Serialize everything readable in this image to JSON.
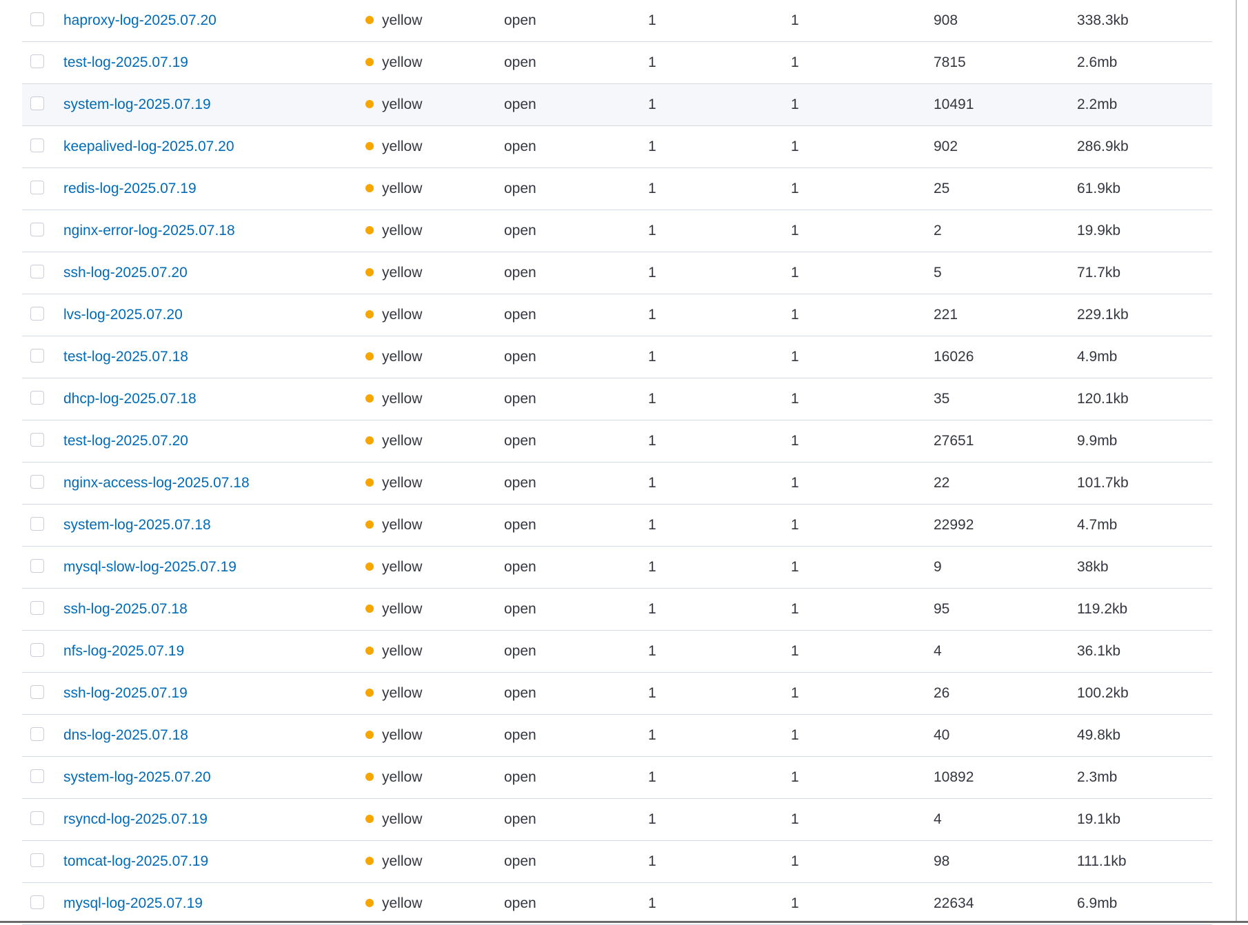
{
  "colors": {
    "health_yellow": "#f5a700",
    "link": "#006bb8",
    "text": "#343741",
    "row_border": "#d3dae6",
    "hover_row": "#f5f7fa"
  },
  "rows": [
    {
      "name": "haproxy-log-2025.07.20",
      "health": "yellow",
      "status": "open",
      "primaries": "1",
      "replicas": "1",
      "docs_count": "908",
      "storage_size": "338.3kb"
    },
    {
      "name": "test-log-2025.07.19",
      "health": "yellow",
      "status": "open",
      "primaries": "1",
      "replicas": "1",
      "docs_count": "7815",
      "storage_size": "2.6mb"
    },
    {
      "name": "system-log-2025.07.19",
      "health": "yellow",
      "status": "open",
      "primaries": "1",
      "replicas": "1",
      "docs_count": "10491",
      "storage_size": "2.2mb"
    },
    {
      "name": "keepalived-log-2025.07.20",
      "health": "yellow",
      "status": "open",
      "primaries": "1",
      "replicas": "1",
      "docs_count": "902",
      "storage_size": "286.9kb"
    },
    {
      "name": "redis-log-2025.07.19",
      "health": "yellow",
      "status": "open",
      "primaries": "1",
      "replicas": "1",
      "docs_count": "25",
      "storage_size": "61.9kb"
    },
    {
      "name": "nginx-error-log-2025.07.18",
      "health": "yellow",
      "status": "open",
      "primaries": "1",
      "replicas": "1",
      "docs_count": "2",
      "storage_size": "19.9kb"
    },
    {
      "name": "ssh-log-2025.07.20",
      "health": "yellow",
      "status": "open",
      "primaries": "1",
      "replicas": "1",
      "docs_count": "5",
      "storage_size": "71.7kb"
    },
    {
      "name": "lvs-log-2025.07.20",
      "health": "yellow",
      "status": "open",
      "primaries": "1",
      "replicas": "1",
      "docs_count": "221",
      "storage_size": "229.1kb"
    },
    {
      "name": "test-log-2025.07.18",
      "health": "yellow",
      "status": "open",
      "primaries": "1",
      "replicas": "1",
      "docs_count": "16026",
      "storage_size": "4.9mb"
    },
    {
      "name": "dhcp-log-2025.07.18",
      "health": "yellow",
      "status": "open",
      "primaries": "1",
      "replicas": "1",
      "docs_count": "35",
      "storage_size": "120.1kb"
    },
    {
      "name": "test-log-2025.07.20",
      "health": "yellow",
      "status": "open",
      "primaries": "1",
      "replicas": "1",
      "docs_count": "27651",
      "storage_size": "9.9mb"
    },
    {
      "name": "nginx-access-log-2025.07.18",
      "health": "yellow",
      "status": "open",
      "primaries": "1",
      "replicas": "1",
      "docs_count": "22",
      "storage_size": "101.7kb"
    },
    {
      "name": "system-log-2025.07.18",
      "health": "yellow",
      "status": "open",
      "primaries": "1",
      "replicas": "1",
      "docs_count": "22992",
      "storage_size": "4.7mb"
    },
    {
      "name": "mysql-slow-log-2025.07.19",
      "health": "yellow",
      "status": "open",
      "primaries": "1",
      "replicas": "1",
      "docs_count": "9",
      "storage_size": "38kb"
    },
    {
      "name": "ssh-log-2025.07.18",
      "health": "yellow",
      "status": "open",
      "primaries": "1",
      "replicas": "1",
      "docs_count": "95",
      "storage_size": "119.2kb"
    },
    {
      "name": "nfs-log-2025.07.19",
      "health": "yellow",
      "status": "open",
      "primaries": "1",
      "replicas": "1",
      "docs_count": "4",
      "storage_size": "36.1kb"
    },
    {
      "name": "ssh-log-2025.07.19",
      "health": "yellow",
      "status": "open",
      "primaries": "1",
      "replicas": "1",
      "docs_count": "26",
      "storage_size": "100.2kb"
    },
    {
      "name": "dns-log-2025.07.18",
      "health": "yellow",
      "status": "open",
      "primaries": "1",
      "replicas": "1",
      "docs_count": "40",
      "storage_size": "49.8kb"
    },
    {
      "name": "system-log-2025.07.20",
      "health": "yellow",
      "status": "open",
      "primaries": "1",
      "replicas": "1",
      "docs_count": "10892",
      "storage_size": "2.3mb"
    },
    {
      "name": "rsyncd-log-2025.07.19",
      "health": "yellow",
      "status": "open",
      "primaries": "1",
      "replicas": "1",
      "docs_count": "4",
      "storage_size": "19.1kb"
    },
    {
      "name": "tomcat-log-2025.07.19",
      "health": "yellow",
      "status": "open",
      "primaries": "1",
      "replicas": "1",
      "docs_count": "98",
      "storage_size": "111.1kb"
    },
    {
      "name": "mysql-log-2025.07.19",
      "health": "yellow",
      "status": "open",
      "primaries": "1",
      "replicas": "1",
      "docs_count": "22634",
      "storage_size": "6.9mb"
    }
  ]
}
